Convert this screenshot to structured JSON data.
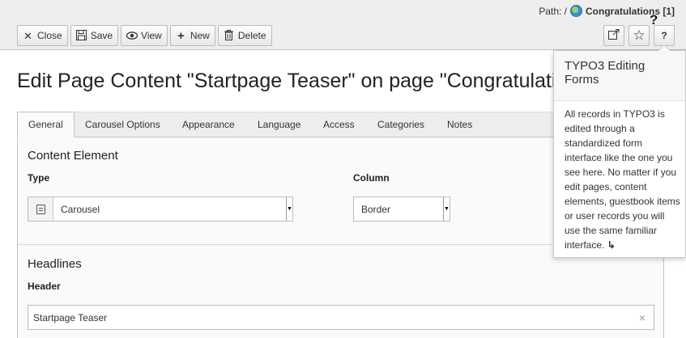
{
  "header": {
    "path_label": "Path: /",
    "page_name": "Congratulations [1]"
  },
  "toolbar": {
    "close_label": "Close",
    "save_label": "Save",
    "view_label": "View",
    "new_label": "New",
    "delete_label": "Delete",
    "help_label": "?",
    "help_pointer": "?"
  },
  "title": "Edit Page Content \"Startpage Teaser\" on page \"Congratulations\"",
  "tabs": [
    {
      "label": "General"
    },
    {
      "label": "Carousel Options"
    },
    {
      "label": "Appearance"
    },
    {
      "label": "Language"
    },
    {
      "label": "Access"
    },
    {
      "label": "Categories"
    },
    {
      "label": "Notes"
    }
  ],
  "content_element": {
    "section_title": "Content Element",
    "type_label": "Type",
    "type_value": "Carousel",
    "column_label": "Column",
    "column_value": "Border"
  },
  "headlines": {
    "section_title": "Headlines",
    "header_label": "Header",
    "header_value": "Startpage Teaser",
    "clear_icon": "×"
  },
  "popover": {
    "title": "TYPO3 Editing Forms",
    "body": "All records in TYPO3 is edited through a standardized form interface like the one you see here. No matter if you edit pages, content elements, guestbook items or user records you will use the same familiar interface.",
    "more_icon": "↳"
  },
  "icons": {
    "close": "✕",
    "save": "save-icon",
    "view": "eye-icon",
    "new": "+",
    "delete": "trash-icon",
    "external": "external-link-icon",
    "bookmark": "☆"
  }
}
